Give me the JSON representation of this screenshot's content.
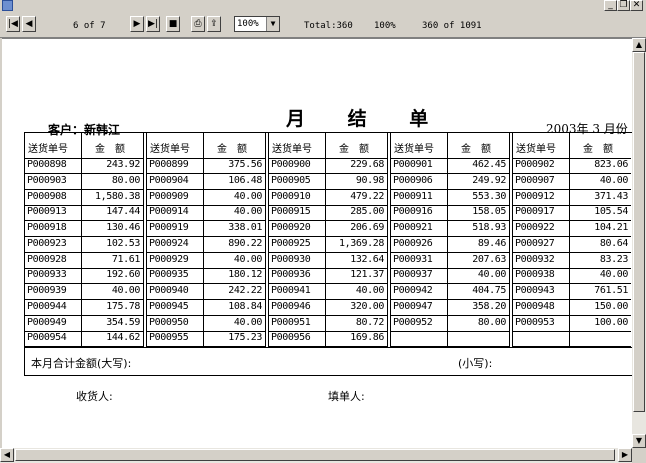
{
  "toolbar": {
    "page_info": "6 of 7",
    "zoom": "100%",
    "total": "Total:360",
    "percent": "100%",
    "records": "360 of 1091"
  },
  "report": {
    "title": "月 结 单",
    "customer": "客户：新韩江",
    "date": "2003年 3 月份",
    "col_headers": {
      "code": "送货单号",
      "amount": "金　额"
    },
    "total_label": "本月合计金额(大写):",
    "small_label": "(小写):",
    "receiver_label": "收货人:",
    "filler_label": "填单人:",
    "groups": [
      {
        "rows": [
          {
            "code": "P000898",
            "amount": "243.92"
          },
          {
            "code": "P000903",
            "amount": "80.00"
          },
          {
            "code": "P000908",
            "amount": "1,580.38"
          },
          {
            "code": "P000913",
            "amount": "147.44"
          },
          {
            "code": "P000918",
            "amount": "130.46"
          },
          {
            "code": "P000923",
            "amount": "102.53"
          },
          {
            "code": "P000928",
            "amount": "71.61"
          },
          {
            "code": "P000933",
            "amount": "192.60"
          },
          {
            "code": "P000939",
            "amount": "40.00"
          },
          {
            "code": "P000944",
            "amount": "175.78"
          },
          {
            "code": "P000949",
            "amount": "354.59"
          },
          {
            "code": "P000954",
            "amount": "144.62"
          }
        ]
      },
      {
        "rows": [
          {
            "code": "P000899",
            "amount": "375.56"
          },
          {
            "code": "P000904",
            "amount": "106.48"
          },
          {
            "code": "P000909",
            "amount": "40.00"
          },
          {
            "code": "P000914",
            "amount": "40.00"
          },
          {
            "code": "P000919",
            "amount": "338.01"
          },
          {
            "code": "P000924",
            "amount": "890.22"
          },
          {
            "code": "P000929",
            "amount": "40.00"
          },
          {
            "code": "P000935",
            "amount": "180.12"
          },
          {
            "code": "P000940",
            "amount": "242.22"
          },
          {
            "code": "P000945",
            "amount": "108.84"
          },
          {
            "code": "P000950",
            "amount": "40.00"
          },
          {
            "code": "P000955",
            "amount": "175.23"
          }
        ]
      },
      {
        "rows": [
          {
            "code": "P000900",
            "amount": "229.68"
          },
          {
            "code": "P000905",
            "amount": "90.98"
          },
          {
            "code": "P000910",
            "amount": "479.22"
          },
          {
            "code": "P000915",
            "amount": "285.00"
          },
          {
            "code": "P000920",
            "amount": "206.69"
          },
          {
            "code": "P000925",
            "amount": "1,369.28"
          },
          {
            "code": "P000930",
            "amount": "132.64"
          },
          {
            "code": "P000936",
            "amount": "121.37"
          },
          {
            "code": "P000941",
            "amount": "40.00"
          },
          {
            "code": "P000946",
            "amount": "320.00"
          },
          {
            "code": "P000951",
            "amount": "80.72"
          },
          {
            "code": "P000956",
            "amount": "169.86"
          }
        ]
      },
      {
        "rows": [
          {
            "code": "P000901",
            "amount": "462.45"
          },
          {
            "code": "P000906",
            "amount": "249.92"
          },
          {
            "code": "P000911",
            "amount": "553.30"
          },
          {
            "code": "P000916",
            "amount": "158.05"
          },
          {
            "code": "P000921",
            "amount": "518.93"
          },
          {
            "code": "P000926",
            "amount": "89.46"
          },
          {
            "code": "P000931",
            "amount": "207.63"
          },
          {
            "code": "P000937",
            "amount": "40.00"
          },
          {
            "code": "P000942",
            "amount": "404.75"
          },
          {
            "code": "P000947",
            "amount": "358.20"
          },
          {
            "code": "P000952",
            "amount": "80.00"
          },
          {
            "code": "",
            "amount": ""
          }
        ]
      },
      {
        "rows": [
          {
            "code": "P000902",
            "amount": "823.06"
          },
          {
            "code": "P000907",
            "amount": "40.00"
          },
          {
            "code": "P000912",
            "amount": "371.43"
          },
          {
            "code": "P000917",
            "amount": "105.54"
          },
          {
            "code": "P000922",
            "amount": "104.21"
          },
          {
            "code": "P000927",
            "amount": "80.64"
          },
          {
            "code": "P000932",
            "amount": "83.23"
          },
          {
            "code": "P000938",
            "amount": "40.00"
          },
          {
            "code": "P000943",
            "amount": "761.51"
          },
          {
            "code": "P000948",
            "amount": "150.00"
          },
          {
            "code": "P000953",
            "amount": "100.00"
          },
          {
            "code": "",
            "amount": ""
          }
        ]
      }
    ]
  }
}
